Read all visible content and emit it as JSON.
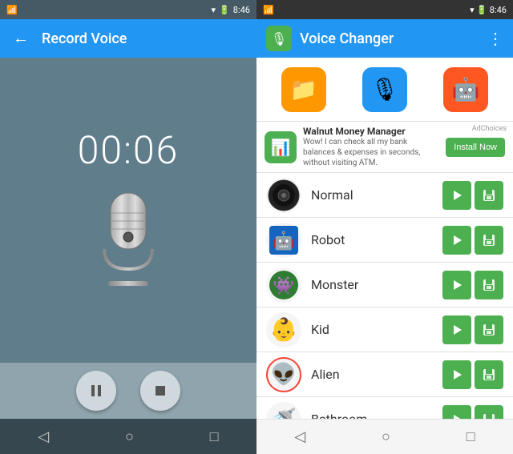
{
  "left": {
    "status_bar": {
      "time": "8:46",
      "icons_left": "signal",
      "icons_right": "wifi battery"
    },
    "app_bar": {
      "title": "Record Voice",
      "back_label": "←"
    },
    "timer": "00:06",
    "controls": {
      "pause_label": "⏸",
      "stop_label": "⏹"
    },
    "nav": {
      "back": "◁",
      "home": "○",
      "recent": "□"
    }
  },
  "right": {
    "status_bar": {
      "time": "8:46"
    },
    "app_bar": {
      "title": "Voice Changer",
      "menu_label": "⋮"
    },
    "ad": {
      "choices_label": "AdChoices",
      "title": "Walnut Money Manager",
      "desc": "Wow! I can check all my bank balances & expenses in seconds, without visiting ATM.",
      "btn_label": "Install Now"
    },
    "voice_items": [
      {
        "name": "Normal",
        "icon": "🔊",
        "bg": "#212121"
      },
      {
        "name": "Robot",
        "icon": "🤖",
        "bg": "#1565c0"
      },
      {
        "name": "Monster",
        "icon": "👾",
        "bg": "#1b5e20"
      },
      {
        "name": "Kid",
        "icon": "👶",
        "bg": "#f5f5f5"
      },
      {
        "name": "Alien",
        "icon": "👽",
        "bg": "#f5f5f5"
      },
      {
        "name": "Bathroom",
        "icon": "🚿",
        "bg": "#f5f5f5"
      }
    ],
    "nav": {
      "back": "◁",
      "home": "○",
      "recent": "□"
    }
  }
}
